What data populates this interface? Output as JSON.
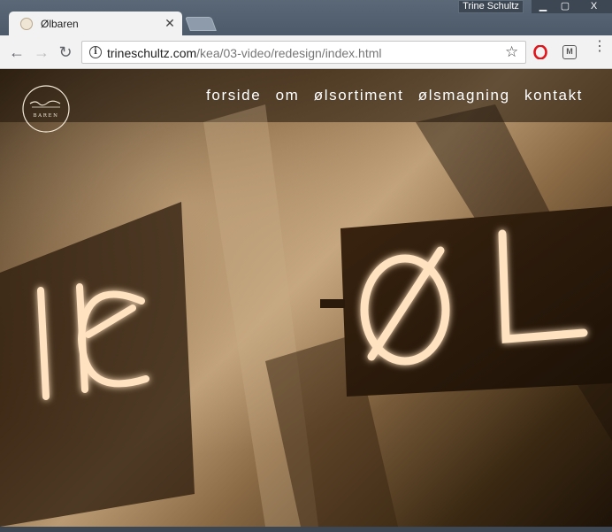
{
  "tab": {
    "title": "Ølbaren",
    "close": "✕"
  },
  "window": {
    "profile": "Trine Schultz",
    "minimize": "▁",
    "maximize": "▢",
    "close": "X"
  },
  "toolbar": {
    "back": "←",
    "forward": "→",
    "reload": "↻",
    "url_host": "trineschultz.com",
    "url_path": "/kea/03-video/redesign/index.html",
    "info": "i",
    "star": "☆",
    "ext_m": "M",
    "menu": "⋮"
  },
  "site": {
    "logo_text": "BAREN",
    "nav": [
      "forside",
      "om",
      "ølsortiment",
      "ølsmagning",
      "kontakt"
    ],
    "sign_text": "ØL"
  },
  "colors": {
    "sepia_light": "#ffe2c0",
    "sepia_dark": "#2b1c0c",
    "opera_red": "#e0151b"
  }
}
